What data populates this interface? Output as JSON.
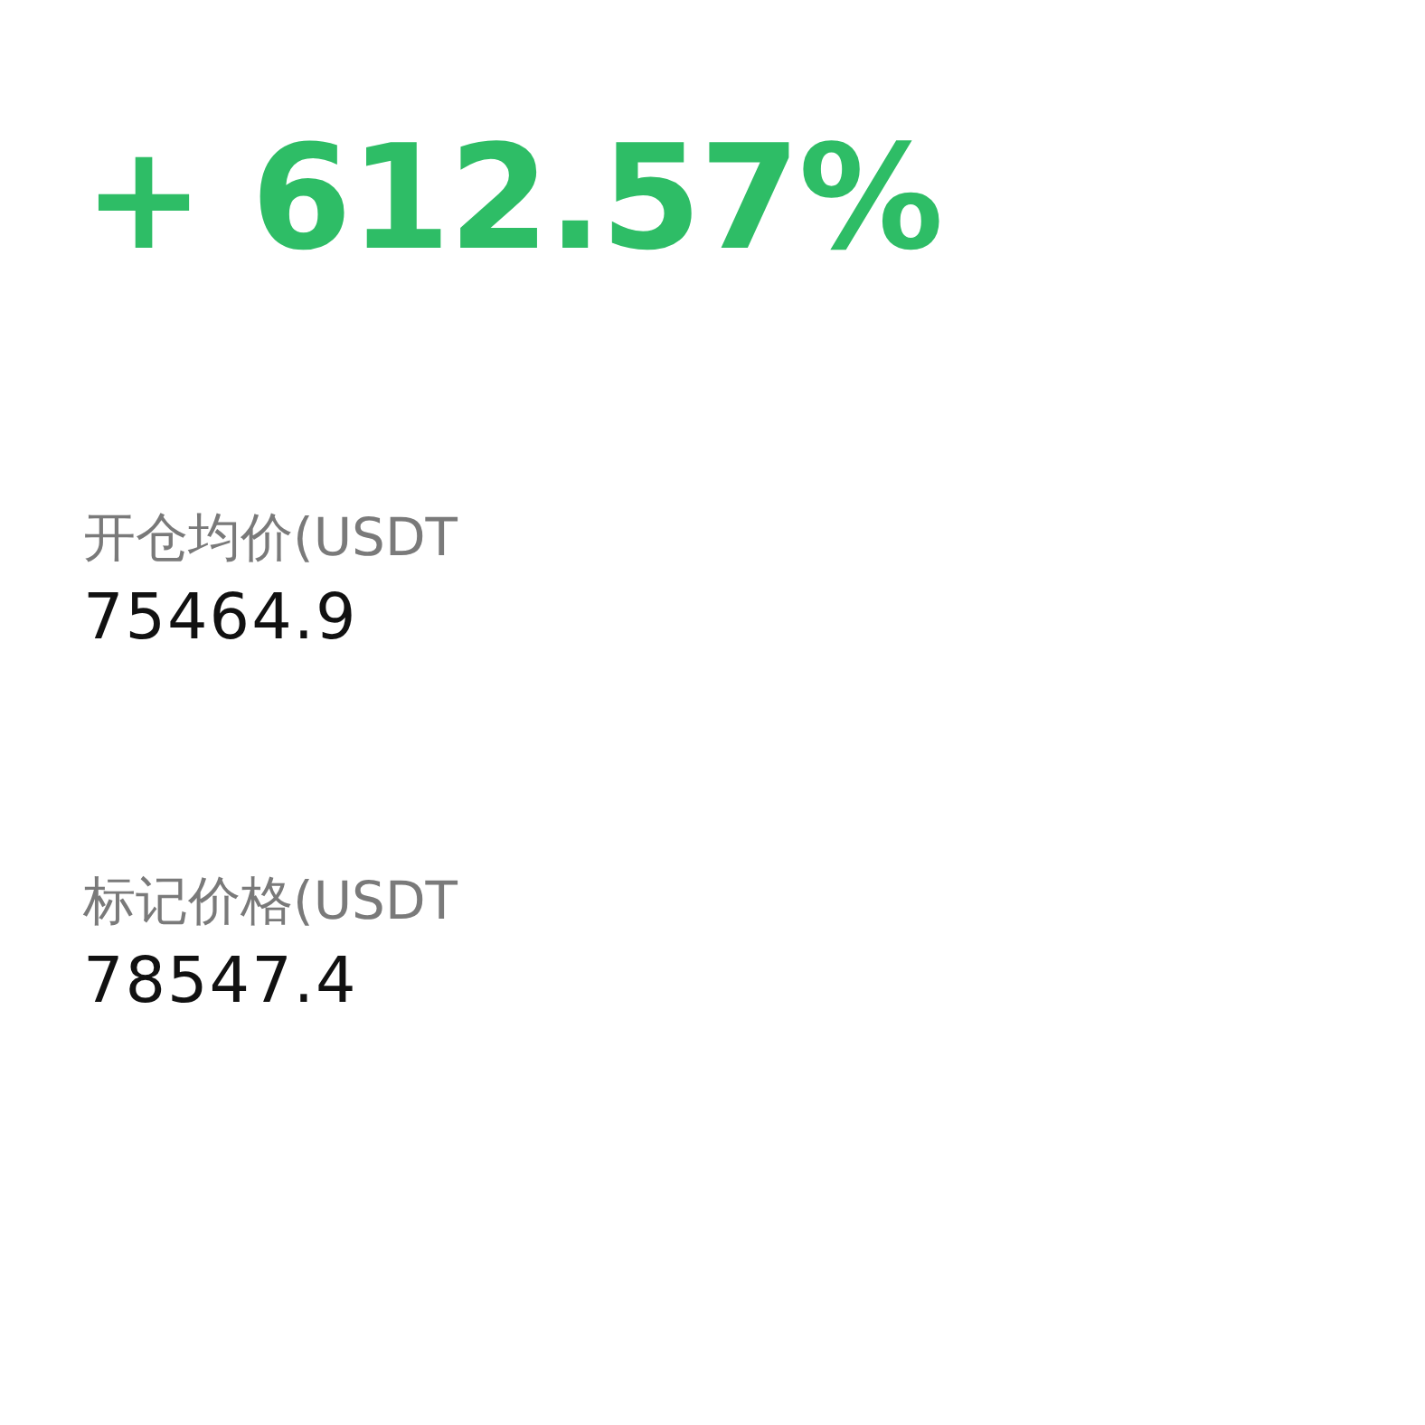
{
  "pnl_percent": "+ 612.57%",
  "fields": [
    {
      "label": "开仓均价(USDT",
      "value": "75464.9"
    },
    {
      "label": "标记价格(USDT",
      "value": "78547.4"
    }
  ]
}
